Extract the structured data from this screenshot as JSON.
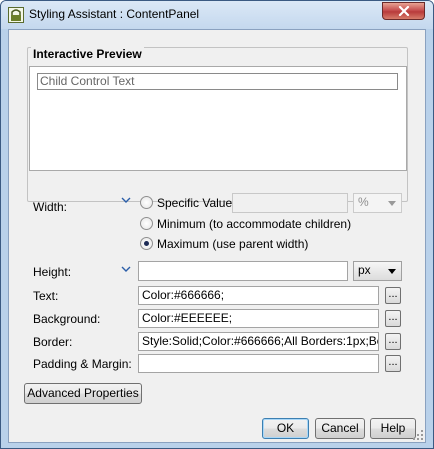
{
  "window": {
    "title": "Styling Assistant : ContentPanel",
    "icon": "app-icon",
    "close_icon": "close-icon"
  },
  "preview": {
    "group_label": "Interactive Preview",
    "child_text": "Child Control Text"
  },
  "width": {
    "label": "Width:",
    "options": [
      {
        "label": "Specific Value",
        "checked": false
      },
      {
        "label": "Minimum (to accommodate children)",
        "checked": false
      },
      {
        "label": "Maximum (use parent width)",
        "checked": true
      }
    ],
    "value": "",
    "unit": "%"
  },
  "height": {
    "label": "Height:",
    "value": "",
    "unit": "px"
  },
  "text": {
    "label": "Text:",
    "value": "Color:#666666;"
  },
  "background": {
    "label": "Background:",
    "value": "Color:#EEEEEE;"
  },
  "border": {
    "label": "Border:",
    "value": "Style:Solid;Color:#666666;All Borders:1px;Bor"
  },
  "padding": {
    "label": "Padding & Margin:",
    "value": ""
  },
  "buttons": {
    "ellipsis": "...",
    "advanced": "Advanced Properties",
    "ok": "OK",
    "cancel": "Cancel",
    "help": "Help"
  },
  "colors": {
    "window_frame": "#b9d1ea",
    "client_bg": "#f0f0f0",
    "preview_text": "#666666",
    "close_red": "#c75050"
  }
}
